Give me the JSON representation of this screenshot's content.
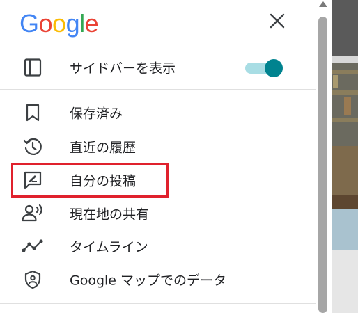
{
  "header": {
    "logo_letters": [
      {
        "char": "G",
        "color": "#4285F4"
      },
      {
        "char": "o",
        "color": "#EA4335"
      },
      {
        "char": "o",
        "color": "#FBBC05"
      },
      {
        "char": "g",
        "color": "#4285F4"
      },
      {
        "char": "l",
        "color": "#34A853"
      },
      {
        "char": "e",
        "color": "#EA4335"
      }
    ],
    "close_icon": "close-icon"
  },
  "menu": {
    "sidebar_toggle": {
      "label": "サイドバーを表示",
      "icon": "sidebar-icon",
      "enabled": true
    },
    "items": [
      {
        "label": "保存済み",
        "icon": "bookmark-icon"
      },
      {
        "label": "直近の履歴",
        "icon": "history-icon"
      },
      {
        "label": "自分の投稿",
        "icon": "contribution-icon"
      },
      {
        "label": "現在地の共有",
        "icon": "location-sharing-icon"
      },
      {
        "label": "タイムライン",
        "icon": "timeline-icon"
      },
      {
        "label": "Google マップでのデータ",
        "icon": "shield-icon"
      }
    ]
  },
  "colors": {
    "text": "#202124",
    "icon": "#3c4043",
    "toggle_track": "#a8dde4",
    "toggle_knob": "#00838f",
    "highlight": "#e0212d"
  }
}
